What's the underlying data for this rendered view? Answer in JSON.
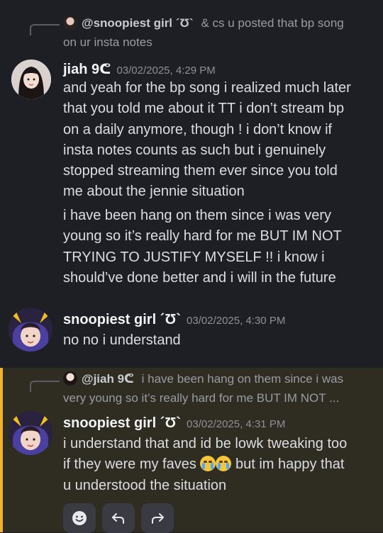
{
  "messages": [
    {
      "reply": {
        "name": "@snoopiest girl ´Ʊ`",
        "snippet_line1": "& cs u posted that bp song",
        "snippet_line2": "on ur insta notes"
      },
      "author": "jiah 9ᕦ",
      "timestamp": "03/02/2025, 4:29 PM",
      "paragraphs": [
        [
          "and yeah for the bp song i realized much later",
          "that you told me about it TT i don’t stream bp",
          "on a daily anymore, though ! i don’t know if",
          "insta notes counts as such but i genuinely",
          "stopped streaming them ever since you told",
          "me about the jennie situation"
        ],
        [
          "i have been hang on them since i was very",
          "young so it’s really hard for me BUT IM NOT",
          "TRYING TO JUSTIFY MYSELF !! i know i",
          "should’ve done better and i will in the future"
        ]
      ]
    },
    {
      "author": "snoopiest girl ´Ʊ`",
      "timestamp": "03/02/2025, 4:30 PM",
      "text": "no no i understand"
    },
    {
      "reply": {
        "name": "@jiah 9ᕦ",
        "snippet_line1": "i have been hang on them since i was",
        "snippet_line2": "very young so it’s really hard for me BUT IM NOT ..."
      },
      "author": "snoopiest girl ´Ʊ`",
      "timestamp": "03/02/2025, 4:31 PM",
      "line1": "i understand that and id be lowk tweaking too",
      "line2_before": "if they were my faves",
      "line2_after": " but im happy that",
      "line3": "u understood the situation",
      "emoji": "loudly-crying-face-icon"
    }
  ],
  "actions": [
    "add-reaction-icon",
    "reply-icon",
    "forward-icon"
  ],
  "colors": {
    "highlight_bg": "#2f2c22",
    "highlight_bar": "#f0b232",
    "background": "#1e1f24"
  }
}
